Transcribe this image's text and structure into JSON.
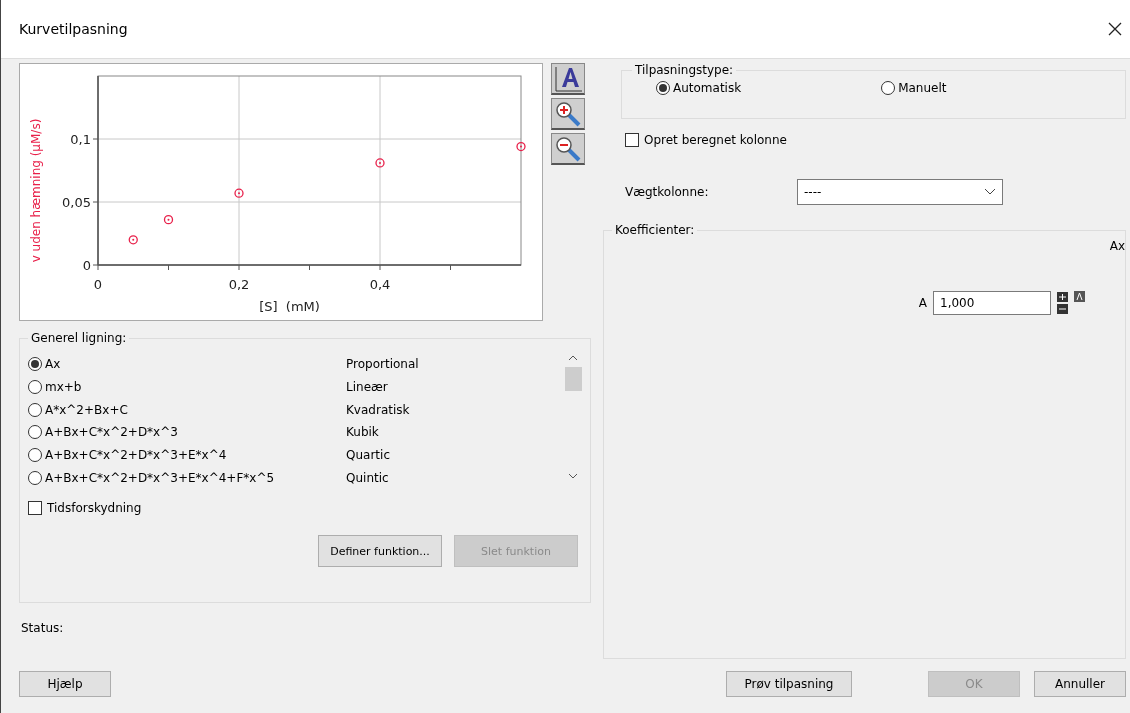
{
  "window": {
    "title": "Kurvetilpasning"
  },
  "chart": {
    "chart_data": {
      "type": "scatter",
      "xlabel": "[S]  (mM)",
      "ylabel": "v uden hæmning (µM/s)",
      "xlim": [
        0,
        0.6
      ],
      "ylim": [
        0,
        0.15
      ],
      "xticks": [
        {
          "value": 0,
          "label": "0"
        },
        {
          "value": 0.2,
          "label": "0,2"
        },
        {
          "value": 0.4,
          "label": "0,4"
        }
      ],
      "yticks": [
        {
          "value": 0,
          "label": "0"
        },
        {
          "value": 0.05,
          "label": "0,05"
        },
        {
          "value": 0.1,
          "label": "0,1"
        }
      ],
      "grid": true,
      "series": [
        {
          "color": "#e8204a",
          "x": [
            0.05,
            0.1,
            0.2,
            0.4,
            0.6
          ],
          "values": [
            0.02,
            0.036,
            0.057,
            0.081,
            0.094
          ]
        }
      ]
    }
  },
  "general_equation": {
    "label": "Generel ligning:",
    "equations": [
      {
        "formula": "Ax",
        "name": "Proportional",
        "selected": true
      },
      {
        "formula": "mx+b",
        "name": "Lineær",
        "selected": false
      },
      {
        "formula": "A*x^2+Bx+C",
        "name": "Kvadratisk",
        "selected": false
      },
      {
        "formula": "A+Bx+C*x^2+D*x^3",
        "name": "Kubik",
        "selected": false
      },
      {
        "formula": "A+Bx+C*x^2+D*x^3+E*x^4",
        "name": "Quartic",
        "selected": false
      },
      {
        "formula": "A+Bx+C*x^2+D*x^3+E*x^4+F*x^5",
        "name": "Quintic",
        "selected": false
      }
    ],
    "time_shift": {
      "label": "Tidsforskydning",
      "checked": false
    },
    "buttons": [
      {
        "label": "Definer funktion...",
        "disabled": false
      },
      {
        "label": "Slet funktion",
        "disabled": true
      }
    ]
  },
  "status": {
    "label": "Status:"
  },
  "fit_type": {
    "label": "Tilpasningstype:",
    "options": [
      {
        "label": "Automatisk",
        "selected": true
      },
      {
        "label": "Manuelt",
        "selected": false
      }
    ]
  },
  "create_column": {
    "label": "Opret beregnet kolonne",
    "checked": false
  },
  "weight_column": {
    "label": "Vægtkolonne:",
    "value": "----"
  },
  "coefficients": {
    "label": "Koefficienter:",
    "equation": "Ax",
    "rows": [
      {
        "name": "A",
        "value": "1,000"
      }
    ]
  },
  "footer_buttons": [
    {
      "label": "Hjælp",
      "disabled": false
    },
    {
      "label": "Prøv tilpasning",
      "disabled": false
    },
    {
      "label": "OK",
      "disabled": true
    },
    {
      "label": "Annuller",
      "disabled": false
    }
  ]
}
